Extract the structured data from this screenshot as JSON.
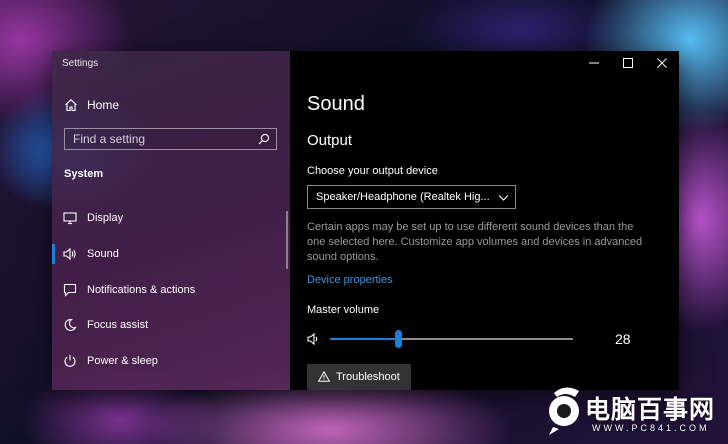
{
  "window": {
    "app_title": "Settings",
    "controls": {
      "minimize_icon": "minimize-icon",
      "maximize_icon": "maximize-icon",
      "close_icon": "close-icon"
    }
  },
  "sidebar": {
    "home": {
      "label": "Home",
      "icon": "home-icon"
    },
    "search": {
      "placeholder": "Find a setting",
      "value": "",
      "icon": "search-icon"
    },
    "section_heading": "System",
    "items": [
      {
        "label": "Display",
        "icon": "display-icon",
        "selected": false
      },
      {
        "label": "Sound",
        "icon": "speaker-icon",
        "selected": true
      },
      {
        "label": "Notifications & actions",
        "icon": "notification-icon",
        "selected": false
      },
      {
        "label": "Focus assist",
        "icon": "moon-icon",
        "selected": false
      },
      {
        "label": "Power & sleep",
        "icon": "power-icon",
        "selected": false
      }
    ]
  },
  "content": {
    "page_title": "Sound",
    "output": {
      "heading": "Output",
      "device_label": "Choose your output device",
      "device_value": "Speaker/Headphone (Realtek Hig...",
      "description": "Certain apps may be set up to use different sound devices than the one selected here. Customize app volumes and devices in advanced sound options.",
      "device_properties_link": "Device properties",
      "master_volume_label": "Master volume",
      "master_volume_value": "28",
      "master_volume_fraction": 0.28,
      "troubleshoot_label": "Troubleshoot"
    }
  },
  "watermark": {
    "brand_text": "电脑百事网",
    "url_text": "WWW.PC841.COM"
  },
  "colors": {
    "accent": "#1e7fd6",
    "link": "#3a96dd",
    "content_background": "#000000",
    "secondary_text": "#9a9a9a"
  }
}
